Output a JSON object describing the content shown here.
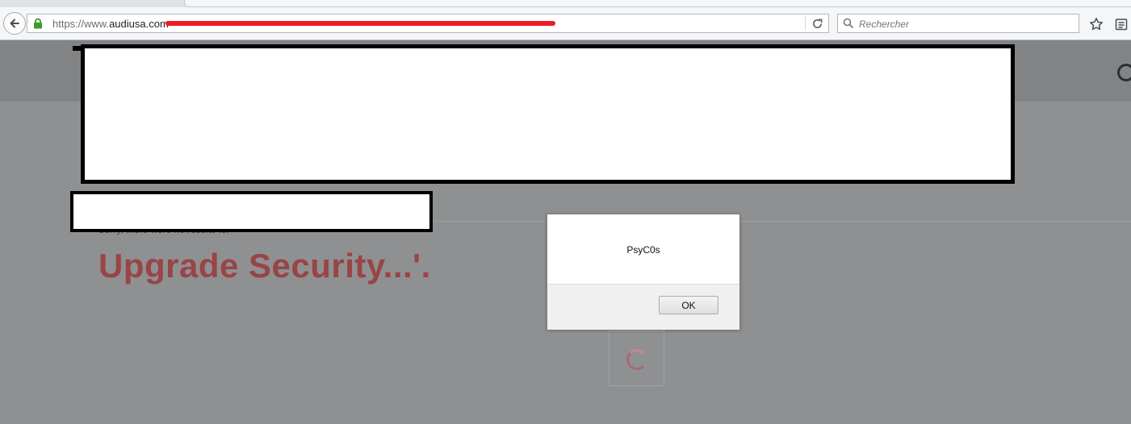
{
  "browser": {
    "url_prefix": "https://www.",
    "url_host": "audiusa.com",
    "search_placeholder": "Rechercher"
  },
  "page": {
    "results_line": "Sorry, there were no results for",
    "search_heading": "Upgrade Security...'."
  },
  "dialog": {
    "message": "PsyC0s",
    "ok_label": "OK"
  },
  "colors": {
    "overlay": "#8f9092",
    "heading": "#994447",
    "redaction": "#ee1c24"
  }
}
